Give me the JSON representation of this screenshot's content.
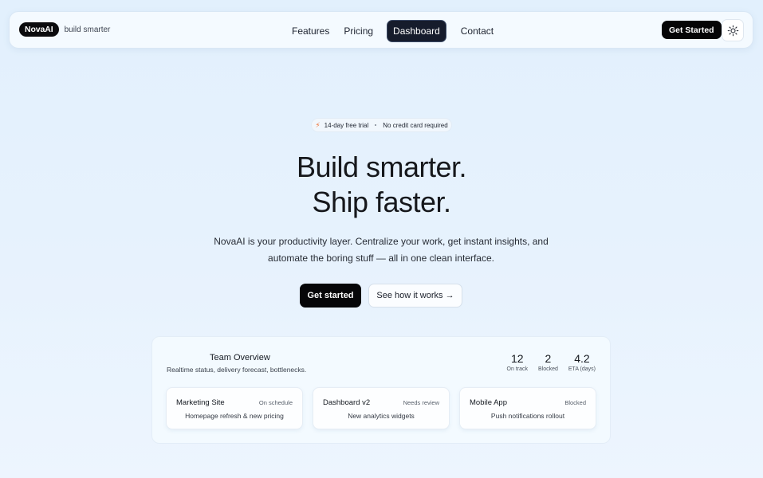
{
  "nav": {
    "logo": "NovaAI",
    "tagline": "build smarter",
    "links": [
      {
        "label": "Features"
      },
      {
        "label": "Pricing"
      },
      {
        "label": "Dashboard",
        "active": true
      },
      {
        "label": "Contact"
      }
    ],
    "cta": "Get Started",
    "theme_icon": "sun-icon"
  },
  "hero": {
    "badge": {
      "icon": "bolt-icon",
      "left": "14-day free trial",
      "right": "No credit card required"
    },
    "title_line1": "Build smarter.",
    "title_line2": "Ship faster.",
    "subtitle_line1": "NovaAI is your productivity layer. Centralize your work, get instant insights, and",
    "subtitle_line2": "automate the boring stuff — all in one clean interface.",
    "primary_cta": "Get started",
    "secondary_cta": "See how it works →"
  },
  "overview": {
    "title": "Team Overview",
    "subtitle": "Realtime status, delivery forecast, bottlenecks.",
    "stats": [
      {
        "value": "12",
        "label": "On track"
      },
      {
        "value": "2",
        "label": "Blocked"
      },
      {
        "value": "4.2",
        "label": "ETA (days)"
      }
    ],
    "cards": [
      {
        "title": "Marketing Site",
        "status": "On schedule",
        "desc": "Homepage refresh & new pricing"
      },
      {
        "title": "Dashboard v2",
        "status": "Needs review",
        "desc": "New analytics widgets"
      },
      {
        "title": "Mobile App",
        "status": "Blocked",
        "desc": "Push notifications rollout"
      }
    ]
  },
  "colors": {
    "accent_dark": "#060608",
    "active_nav": "#161c2c",
    "bolt": "#f06a2a",
    "background": "#e4f1fd"
  }
}
